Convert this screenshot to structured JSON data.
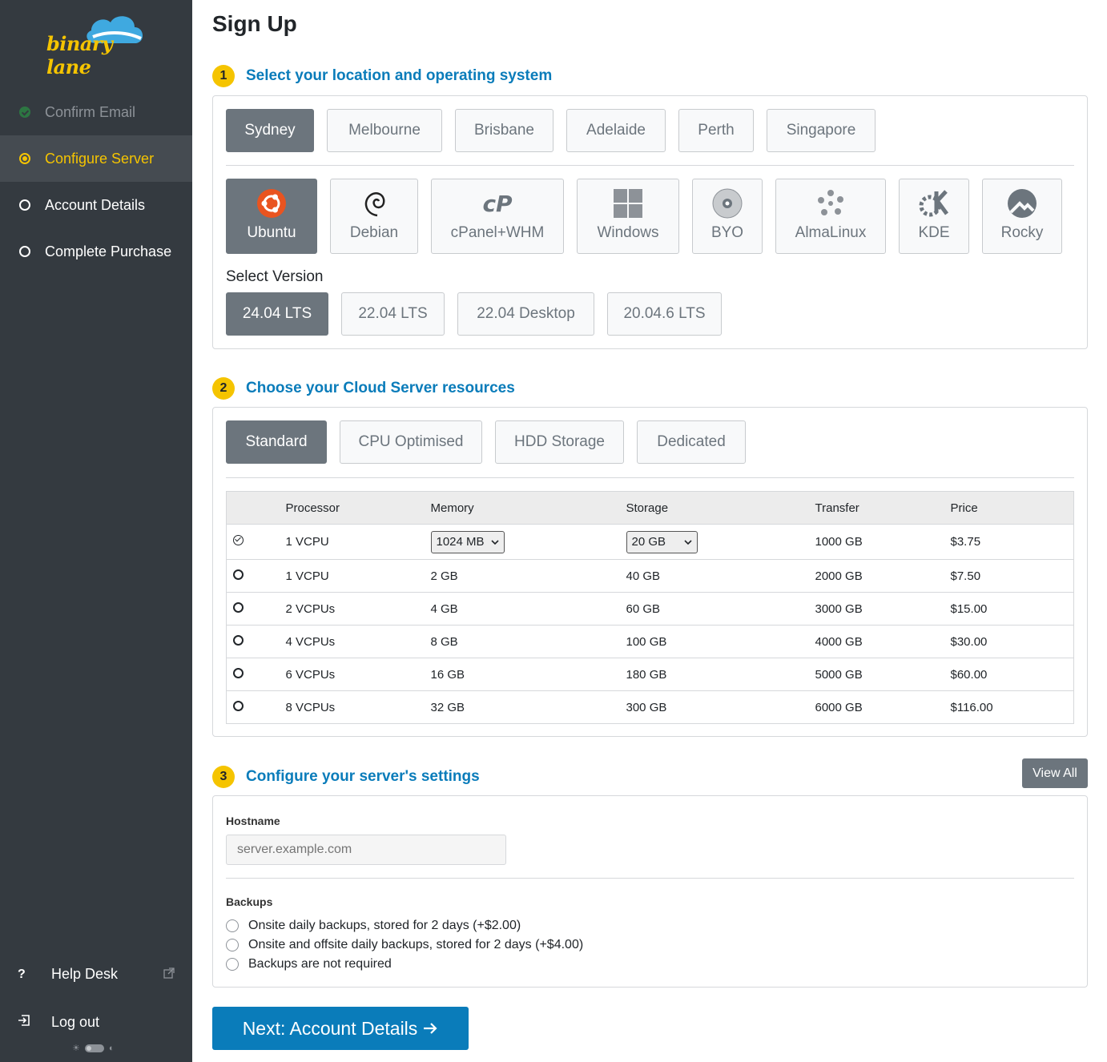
{
  "brand": {
    "name": "binary lane",
    "accent": "#f5c400",
    "primary": "#0a7cba"
  },
  "sidebar": {
    "items": [
      {
        "label": "Confirm Email",
        "state": "done"
      },
      {
        "label": "Configure Server",
        "state": "active"
      },
      {
        "label": "Account Details",
        "state": "pending"
      },
      {
        "label": "Complete Purchase",
        "state": "pending"
      }
    ],
    "help_label": "Help Desk",
    "help_icon": "question-icon",
    "logout_label": "Log out",
    "logout_icon": "logout-icon"
  },
  "page": {
    "title": "Sign Up"
  },
  "step1": {
    "number": "1",
    "title": "Select your location and operating system",
    "locations": [
      "Sydney",
      "Melbourne",
      "Brisbane",
      "Adelaide",
      "Perth",
      "Singapore"
    ],
    "selected_location": "Sydney",
    "os": [
      "Ubuntu",
      "Debian",
      "cPanel+WHM",
      "Windows",
      "BYO",
      "AlmaLinux",
      "KDE",
      "Rocky"
    ],
    "selected_os": "Ubuntu",
    "version_label": "Select Version",
    "versions": [
      "24.04 LTS",
      "22.04 LTS",
      "22.04 Desktop",
      "20.04.6 LTS"
    ],
    "selected_version": "24.04 LTS"
  },
  "step2": {
    "number": "2",
    "title": "Choose your Cloud Server resources",
    "types": [
      "Standard",
      "CPU Optimised",
      "HDD Storage",
      "Dedicated"
    ],
    "selected_type": "Standard",
    "columns": [
      "Processor",
      "Memory",
      "Storage",
      "Transfer",
      "Price"
    ],
    "rows": [
      {
        "processor": "1 VCPU",
        "memory": "1024 MB",
        "storage": "20 GB",
        "transfer": "1000 GB",
        "price": "$3.75",
        "selected": true
      },
      {
        "processor": "1 VCPU",
        "memory": "2 GB",
        "storage": "40 GB",
        "transfer": "2000 GB",
        "price": "$7.50"
      },
      {
        "processor": "2 VCPUs",
        "memory": "4 GB",
        "storage": "60 GB",
        "transfer": "3000 GB",
        "price": "$15.00"
      },
      {
        "processor": "4 VCPUs",
        "memory": "8 GB",
        "storage": "100 GB",
        "transfer": "4000 GB",
        "price": "$30.00"
      },
      {
        "processor": "6 VCPUs",
        "memory": "16 GB",
        "storage": "180 GB",
        "transfer": "5000 GB",
        "price": "$60.00"
      },
      {
        "processor": "8 VCPUs",
        "memory": "32 GB",
        "storage": "300 GB",
        "transfer": "6000 GB",
        "price": "$116.00"
      }
    ]
  },
  "step3": {
    "number": "3",
    "title": "Configure your server's settings",
    "view_all_label": "View All",
    "hostname_label": "Hostname",
    "hostname_placeholder": "server.example.com",
    "backups_label": "Backups",
    "backup_options": [
      "Onsite daily backups, stored for 2 days (+$2.00)",
      "Onsite and offsite daily backups, stored for 2 days (+$4.00)",
      "Backups are not required"
    ]
  },
  "next_button": {
    "label": "Next: Account Details"
  }
}
